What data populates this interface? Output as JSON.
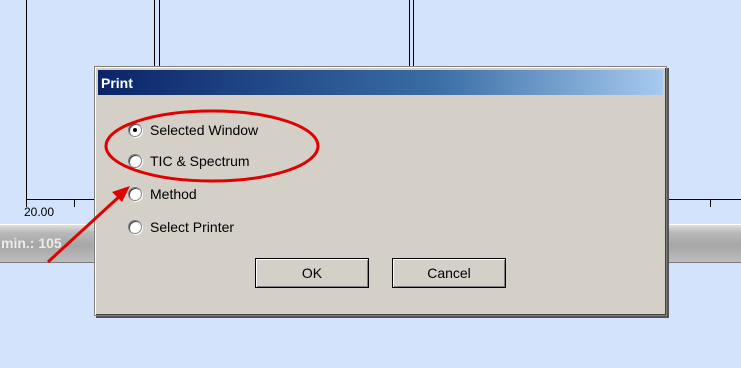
{
  "background_app": {
    "axis_tick_label": "20.00",
    "status_text": "min.: 105"
  },
  "dialog": {
    "title": "Print",
    "options": [
      {
        "label": "Selected Window",
        "selected": true
      },
      {
        "label": "TIC & Spectrum",
        "selected": false
      },
      {
        "label": "Method",
        "selected": false
      },
      {
        "label": "Select Printer",
        "selected": false
      }
    ],
    "ok_label": "OK",
    "cancel_label": "Cancel"
  },
  "annotation": {
    "color": "#e00000",
    "highlight": "red-ellipse",
    "pointer": "red-arrow"
  }
}
